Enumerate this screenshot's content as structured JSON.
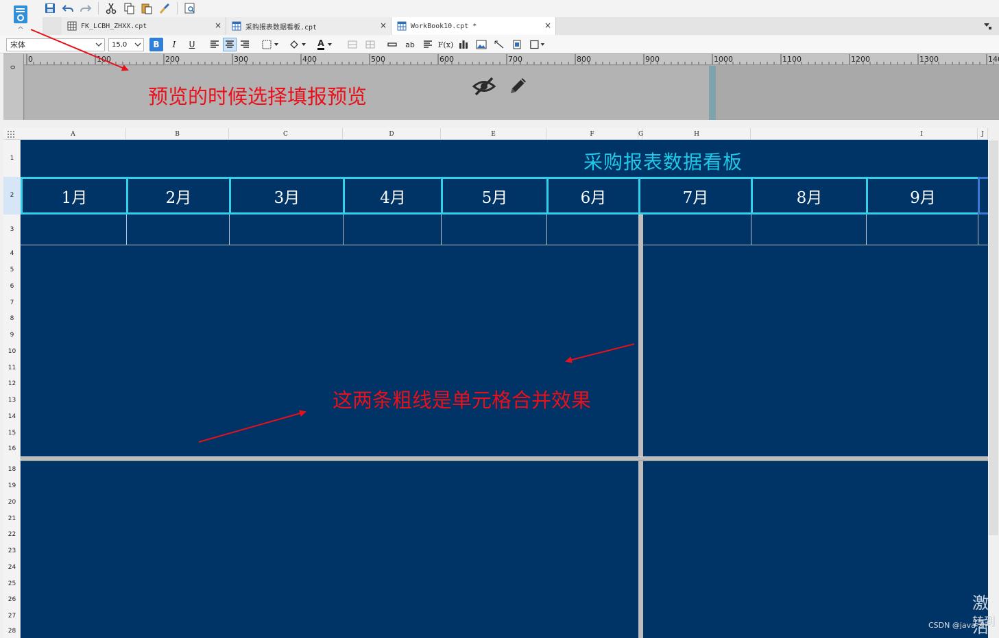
{
  "tabs": [
    {
      "label": "FK_LCBH_ZHXX.cpt",
      "close": "×"
    },
    {
      "label": "采购报表数据看板.cpt",
      "close": "×"
    },
    {
      "label": "WorkBook10.cpt *",
      "close": "×"
    }
  ],
  "format_bar": {
    "font_family": "宋体",
    "font_size": "15.0",
    "bold": "B",
    "italic": "I",
    "underline": "U",
    "text_sample": "ab",
    "formula": "F(x)",
    "font_color_letter": "A"
  },
  "ruler": {
    "h_labels": [
      "0",
      "100",
      "200",
      "300",
      "400",
      "500",
      "600",
      "700",
      "800",
      "900",
      "1000",
      "1100",
      "1200",
      "1300",
      "140"
    ],
    "v_label": "0"
  },
  "sheet": {
    "columns": [
      "A",
      "B",
      "C",
      "D",
      "E",
      "F",
      "G",
      "H",
      "I",
      "J"
    ],
    "rows": [
      "1",
      "2",
      "3",
      "4",
      "5",
      "6",
      "7",
      "8",
      "9",
      "10",
      "11",
      "12",
      "13",
      "14",
      "15",
      "16",
      "18",
      "19",
      "20",
      "21",
      "22",
      "23",
      "24",
      "25",
      "26",
      "27",
      "28"
    ],
    "title": "采购报表数据看板",
    "months": [
      "1月",
      "2月",
      "3月",
      "4月",
      "5月",
      "6月",
      "7月",
      "8月",
      "9月"
    ]
  },
  "annotations": {
    "preview": "预览的时候选择填报预览",
    "merge": "这两条粗线是单元格合并效果"
  },
  "watermark": {
    "activate": "激活",
    "goto": "转到",
    "csdn": "CSDN @java-zh"
  },
  "colors": {
    "grid_background": "#003366",
    "title_color": "#1ec8e6",
    "month_border": "#34cfe8",
    "annotation_red": "#e8101a"
  }
}
